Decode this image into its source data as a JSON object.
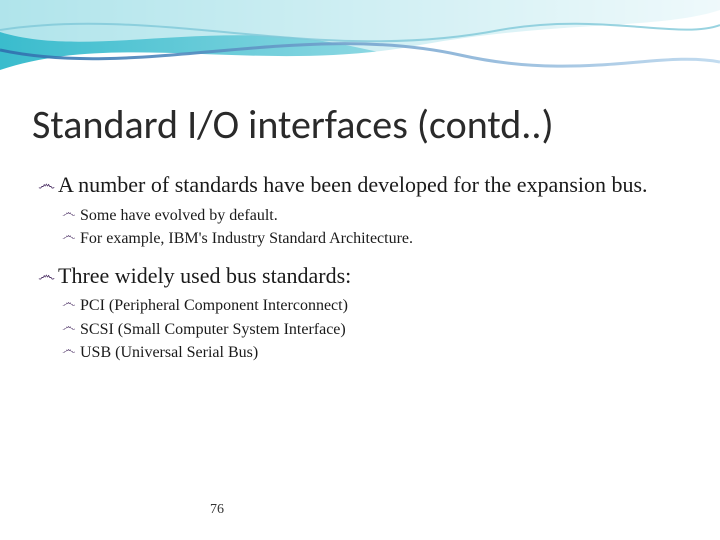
{
  "title": "Standard I/O interfaces (contd..)",
  "bullets": {
    "b1": "A number of standards have been developed for the expansion bus.",
    "b1a": "Some have evolved by default.",
    "b1b": "For example, IBM's Industry Standard Architecture.",
    "b2": "Three widely used bus standards:",
    "b2a": "PCI (Peripheral Component Interconnect)",
    "b2b": "SCSI (Small Computer System Interface)",
    "b2c": "USB (Universal Serial Bus)"
  },
  "page_number": "76",
  "bullet_glyph": "෴"
}
